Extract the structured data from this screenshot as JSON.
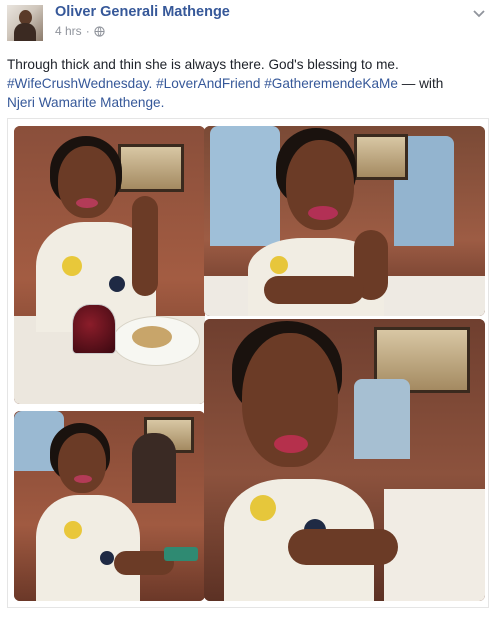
{
  "post": {
    "author": "Oliver Generali Mathenge",
    "time": "4 hrs",
    "separator": "·",
    "text_main": "Through thick and thin she is always there. God's blessing to me.",
    "hashtags": [
      "#WifeCrushWednesday.",
      "#LoverAndFriend",
      "#GatheremendeKaMe"
    ],
    "with_prefix": "— with",
    "tagged_person": "Njeri Wamarite Mathenge."
  },
  "colors": {
    "link": "#365899",
    "text": "#1d2129",
    "meta": "#90949c"
  },
  "icons": {
    "privacy": "globe-icon",
    "menu": "chevron-down-icon"
  }
}
